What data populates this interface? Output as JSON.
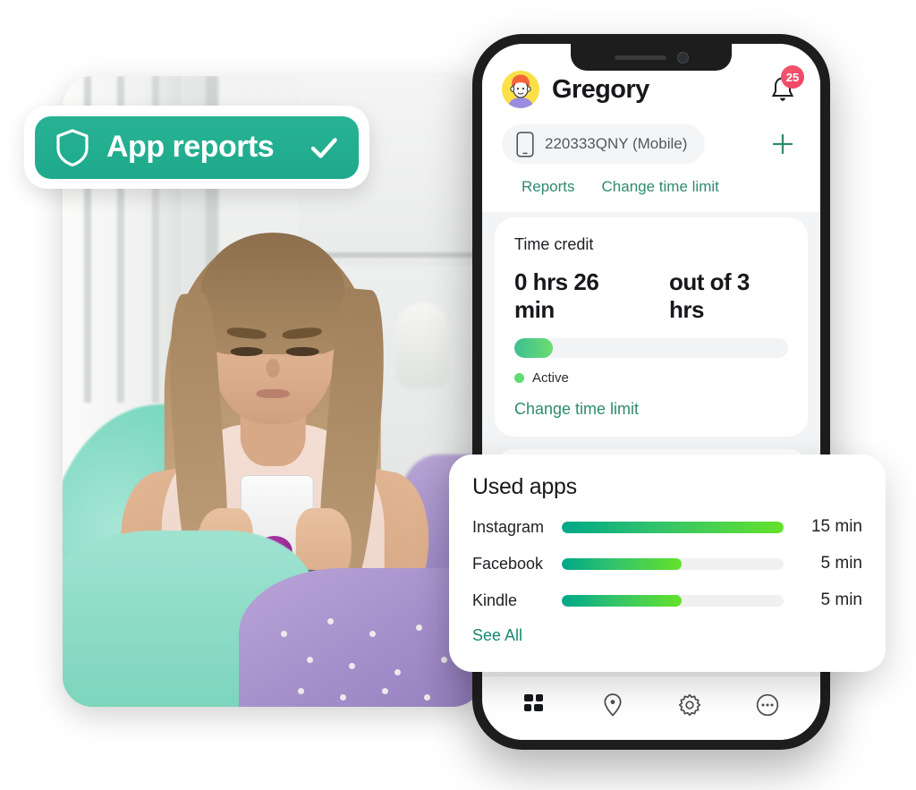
{
  "promo_badge": {
    "label": "App reports",
    "shield_icon": "shield-icon",
    "check_icon": "check-icon",
    "accent": "#1fa98c"
  },
  "photo": {
    "alt": "teen-girl-on-bed-using-smartphone"
  },
  "phone_app": {
    "header": {
      "avatar_icon": "avatar-boy-icon",
      "profile_name": "Gregory",
      "bell_icon": "bell-icon",
      "notification_count": "25",
      "badge_color": "#ee4666"
    },
    "device_selector": {
      "phone_icon": "mobile-device-icon",
      "device_name": "220333QNY (Mobile)",
      "add_icon": "plus-icon",
      "add_color": "#2e8b6f"
    },
    "tabs": [
      {
        "label": "Reports"
      },
      {
        "label": "Change time limit"
      }
    ],
    "time_credit_card": {
      "title": "Time credit",
      "used": "0 hrs 26 min",
      "total": "out of 3 hrs",
      "progress_percent": 14,
      "status": "Active",
      "status_color": "#5fdc72",
      "link": "Change time limit",
      "link_color": "#2e8b6f"
    },
    "bottom_nav": [
      {
        "icon": "dashboard-grid-icon",
        "active": true
      },
      {
        "icon": "location-pin-icon",
        "active": false
      },
      {
        "icon": "gear-icon",
        "active": false
      },
      {
        "icon": "more-dots-icon",
        "active": false
      }
    ]
  },
  "used_apps_card": {
    "title": "Used apps",
    "see_all": "See All",
    "see_all_color": "#188a70",
    "bar_gradient_from": "#00a888",
    "bar_gradient_to": "#63e22a",
    "apps": [
      {
        "name": "Instagram",
        "time": "15 min",
        "percent": 100
      },
      {
        "name": "Facebook",
        "time": "5 min",
        "percent": 54
      },
      {
        "name": "Kindle",
        "time": "5 min",
        "percent": 54
      }
    ]
  },
  "chart_data": {
    "type": "bar",
    "title": "Used apps",
    "categories": [
      "Instagram",
      "Facebook",
      "Kindle"
    ],
    "values": [
      15,
      5,
      5
    ],
    "value_labels": [
      "15 min",
      "5 min",
      "5 min"
    ],
    "bar_fill_percent": [
      100,
      54,
      54
    ],
    "xlabel": "",
    "ylabel": "minutes",
    "orientation": "horizontal",
    "grid": false,
    "legend": false
  }
}
